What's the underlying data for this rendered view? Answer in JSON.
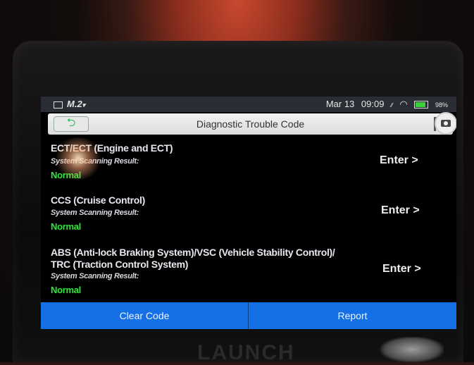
{
  "status_bar": {
    "app_label": "M.2",
    "date": "Mar 13",
    "time": "09:09",
    "battery_percent": "98%"
  },
  "header": {
    "title": "Diagnostic Trouble Code",
    "back_icon": "back-arrow-icon",
    "copy_icon": "copy-icon",
    "camera_icon": "camera-icon"
  },
  "systems": [
    {
      "name_line1": "ECT/ECT (Engine and ECT)",
      "name_line2": "",
      "label": "System Scanning Result:",
      "result": "Normal",
      "enter_label": "Enter >"
    },
    {
      "name_line1": "CCS (Cruise Control)",
      "name_line2": "",
      "label": "System Scanning Result:",
      "result": "Normal",
      "enter_label": "Enter >"
    },
    {
      "name_line1": "ABS (Anti-lock Braking System)/VSC (Vehicle Stability Control)/",
      "name_line2": "TRC (Traction Control System)",
      "label": "System Scanning Result:",
      "result": "Normal",
      "enter_label": "Enter >"
    }
  ],
  "footer": {
    "clear_code_label": "Clear Code",
    "report_label": "Report"
  },
  "device": {
    "brand": "LAUNCH"
  },
  "colors": {
    "accent_blue": "#1570e6",
    "normal_green": "#2ee83a",
    "status_bar_bg": "#2a2d33"
  }
}
